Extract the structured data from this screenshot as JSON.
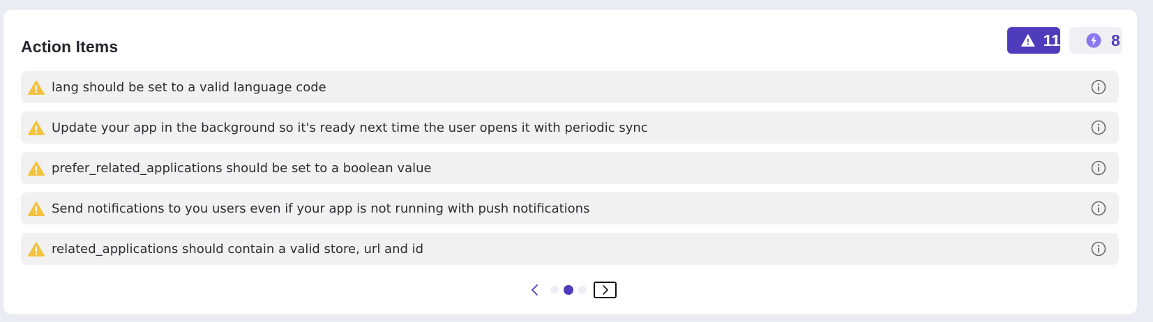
{
  "header": {
    "title": "Action Items"
  },
  "badges": {
    "warnings": {
      "icon": "warning-triangle-icon",
      "count": "11",
      "color": "#4f3cbc"
    },
    "improvements": {
      "icon": "lightning-bolt-icon",
      "count": "8",
      "color": "#4f3cbc"
    }
  },
  "items": [
    {
      "icon": "warning-icon",
      "text": "lang should be set to a valid language code"
    },
    {
      "icon": "warning-icon",
      "text": "Update your app in the background so it's ready next time the user opens it with periodic sync"
    },
    {
      "icon": "warning-icon",
      "text": "prefer_related_applications should be set to a boolean value"
    },
    {
      "icon": "warning-icon",
      "text": "Send notifications to you users even if your app is not running with push notifications"
    },
    {
      "icon": "warning-icon",
      "text": "related_applications should contain a valid store, url and id"
    }
  ],
  "pager": {
    "pages": 3,
    "current": 2,
    "accent": "#4f3cbc"
  },
  "colors": {
    "warning_yellow": "#f3c23f",
    "item_background": "#f1f1f1",
    "accent": "#4f3cbc"
  }
}
